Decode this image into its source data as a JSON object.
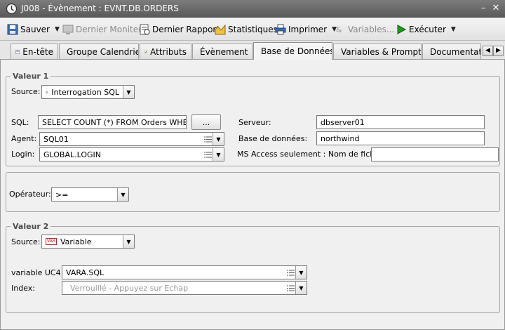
{
  "window": {
    "title": "J008 - Évènement : EVNT.DB.ORDERS",
    "minimize": "–",
    "close": "✕"
  },
  "toolbar": {
    "save": "Sauver",
    "last_monitor": "Dernier Moniteur",
    "last_report": "Dernier Rapport",
    "statistics": "Statistiques",
    "print": "Imprimer",
    "variables": "Variables...",
    "execute": "Exécuter"
  },
  "tabs": [
    {
      "label": "En-tête",
      "icon": "header-icon"
    },
    {
      "label": "Groupe Calendrier",
      "icon": "calendar-icon"
    },
    {
      "label": "Attributs",
      "icon": "attributes-icon"
    },
    {
      "label": "Évènement",
      "icon": "event-icon"
    },
    {
      "label": "Base de Données",
      "icon": "database-icon",
      "active": true
    },
    {
      "label": "Variables & Prompts",
      "icon": "variables-icon"
    },
    {
      "label": "Documentat",
      "icon": "documentation-icon"
    }
  ],
  "value1": {
    "legend": "Valeur 1",
    "source_label": "Source:",
    "source_value": "Interrogation SQL",
    "sql_label": "SQL:",
    "sql_value": "SELECT COUNT (*) FROM Orders WHERE",
    "sql_button": "...",
    "agent_label": "Agent:",
    "agent_value": "SQL01",
    "login_label": "Login:",
    "login_value": "GLOBAL.LOGIN",
    "server_label": "Serveur:",
    "server_value": "dbserver01",
    "database_label": "Base de données:",
    "database_value": "northwind",
    "msaccess_label": "MS Access seulement : Nom de fichier:",
    "msaccess_value": ""
  },
  "operator": {
    "label": "Opérateur:",
    "value": ">="
  },
  "value2": {
    "legend": "Valeur 2",
    "source_label": "Source:",
    "source_value": "Variable",
    "var_badge": "VAR",
    "variable_label": "variable UC4:",
    "variable_value": "VARA.SQL",
    "index_label": "Index:",
    "index_placeholder": "Verrouillé - Appuyez sur Echap"
  },
  "colors": {
    "title_bar": "#6b6b6b",
    "panel_bg": "#f0f0f0",
    "legend_text": "#4a4a4a",
    "execute_green": "#1f9a1f"
  }
}
